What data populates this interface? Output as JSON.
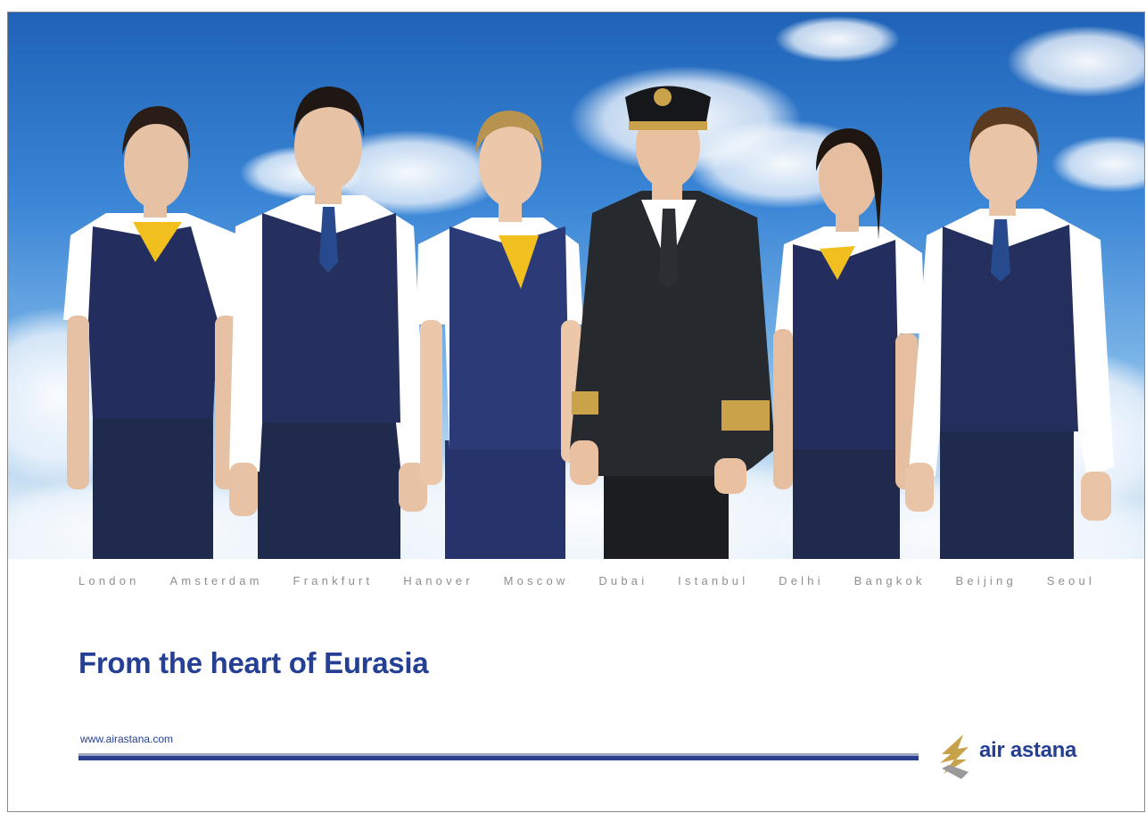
{
  "cities": [
    "London",
    "Amsterdam",
    "Frankfurt",
    "Hanover",
    "Moscow",
    "Dubai",
    "Istanbul",
    "Delhi",
    "Bangkok",
    "Beijing",
    "Seoul"
  ],
  "headline": "From the heart of Eurasia",
  "website": "www.airastana.com",
  "brand": {
    "name": "air astana",
    "logo_icon": "snow-leopard-icon"
  },
  "colors": {
    "brand_blue": "#243f94",
    "city_gray": "#8f8f8f",
    "sky_blue": "#2f7ccc",
    "logo_gold": "#c8a24a"
  },
  "photo": {
    "subject": "crew-photo",
    "people": [
      "flight-attendant-female",
      "flight-attendant-male",
      "flight-attendant-female",
      "captain",
      "flight-attendant-female",
      "flight-attendant-male"
    ]
  }
}
